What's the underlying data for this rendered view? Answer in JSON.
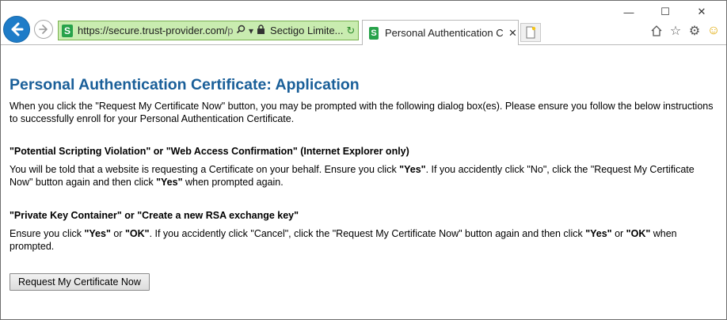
{
  "browser": {
    "address": {
      "url_host": "https://secure.trust-provider.com/",
      "url_rest": "pro",
      "cert_name": "Sectigo Limite...",
      "site_icon": "S"
    },
    "tab": {
      "title": "Personal Authentication Ce...",
      "icon": "S"
    },
    "window_controls": {
      "minimize": "—",
      "maximize": "☐",
      "close": "✕"
    },
    "toolbar_icons": [
      "home-icon",
      "star-icon",
      "gear-icon",
      "smiley-icon"
    ]
  },
  "page": {
    "title": "Personal Authentication Certificate: Application",
    "intro": "When you click the \"Request My Certificate Now\" button, you may be prompted with the following dialog box(es). Please ensure you follow the below instructions to successfully enroll for your Personal Authentication Certificate.",
    "sections": [
      {
        "heading": "\"Potential Scripting Violation\" or \"Web Access Confirmation\" (Internet Explorer only)",
        "parts": [
          "You will be told that a website is requesting a Certificate on your behalf. Ensure you click ",
          "\"Yes\"",
          ". If you accidently click \"No\", click the \"Request My Certificate Now\" button again and then click ",
          "\"Yes\"",
          " when prompted again."
        ]
      },
      {
        "heading": "\"Private Key Container\" or \"Create a new RSA exchange key\"",
        "parts": [
          "Ensure you click ",
          "\"Yes\"",
          " or ",
          "\"OK\"",
          ". If you accidently click \"Cancel\", click the \"Request My Certificate Now\" button again and then click ",
          "\"Yes\"",
          " or ",
          "\"OK\"",
          " when prompted."
        ]
      }
    ],
    "button_label": "Request My Certificate Now"
  },
  "colors": {
    "title": "#1a5f99",
    "address_bg": "#c9ecb0",
    "back_button": "#1e7cc8"
  }
}
